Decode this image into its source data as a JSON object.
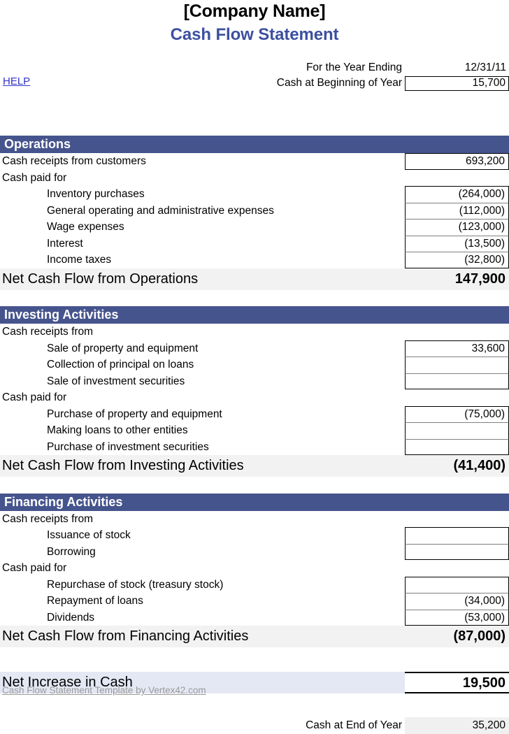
{
  "document": {
    "company_title": "[Company Name]",
    "statement_title": "Cash Flow Statement",
    "help_label": "HELP",
    "footer": "Cash Flow Statement Template by Vertex42.com"
  },
  "colors": {
    "section_header_bg": "#46548d",
    "title_blue": "#3c50a0",
    "net_row_bg": "#f2f2f2",
    "increase_row_bg": "#e4e8f4",
    "end_value_bg": "#f0f0f0",
    "link_blue": "#3333cc",
    "footer_gray": "#9a9a9a"
  },
  "header": {
    "year_ending_label": "For the Year Ending",
    "year_ending_value": "12/31/11",
    "beginning_cash_label": "Cash at Beginning of Year",
    "beginning_cash_value": "15,700"
  },
  "sections": [
    {
      "title": "Operations",
      "groups": [
        {
          "heading": "",
          "items": [
            {
              "label": "Cash receipts from customers",
              "value": "693,200",
              "indent": false
            }
          ]
        },
        {
          "heading": "Cash paid for",
          "items": [
            {
              "label": "Inventory purchases",
              "value": "(264,000)",
              "indent": true
            },
            {
              "label": "General operating and administrative expenses",
              "value": "(112,000)",
              "indent": true
            },
            {
              "label": "Wage expenses",
              "value": "(123,000)",
              "indent": true
            },
            {
              "label": "Interest",
              "value": "(13,500)",
              "indent": true
            },
            {
              "label": "Income taxes",
              "value": "(32,800)",
              "indent": true
            }
          ]
        }
      ],
      "net_label": "Net Cash Flow from Operations",
      "net_value": "147,900"
    },
    {
      "title": "Investing Activities",
      "groups": [
        {
          "heading": "Cash receipts from",
          "items": [
            {
              "label": "Sale of property and equipment",
              "value": "33,600",
              "indent": true
            },
            {
              "label": "Collection of principal on loans",
              "value": "",
              "indent": true
            },
            {
              "label": "Sale of investment securities",
              "value": "",
              "indent": true
            }
          ]
        },
        {
          "heading": "Cash paid for",
          "items": [
            {
              "label": "Purchase of property and equipment",
              "value": "(75,000)",
              "indent": true
            },
            {
              "label": "Making loans to other entities",
              "value": "",
              "indent": true
            },
            {
              "label": "Purchase of investment securities",
              "value": "",
              "indent": true
            }
          ]
        }
      ],
      "net_label": "Net Cash Flow from Investing Activities",
      "net_value": "(41,400)"
    },
    {
      "title": "Financing Activities",
      "groups": [
        {
          "heading": "Cash receipts from",
          "items": [
            {
              "label": "Issuance of stock",
              "value": "",
              "indent": true
            },
            {
              "label": "Borrowing",
              "value": "",
              "indent": true
            }
          ]
        },
        {
          "heading": "Cash paid for",
          "items": [
            {
              "label": "Repurchase of stock (treasury stock)",
              "value": "",
              "indent": true
            },
            {
              "label": "Repayment of loans",
              "value": "(34,000)",
              "indent": true
            },
            {
              "label": "Dividends",
              "value": "(53,000)",
              "indent": true
            }
          ]
        }
      ],
      "net_label": "Net Cash Flow from Financing Activities",
      "net_value": "(87,000)"
    }
  ],
  "summary": {
    "increase_label": "Net Increase in Cash",
    "increase_value": "19,500",
    "end_cash_label": "Cash at End of Year",
    "end_cash_value": "35,200"
  }
}
